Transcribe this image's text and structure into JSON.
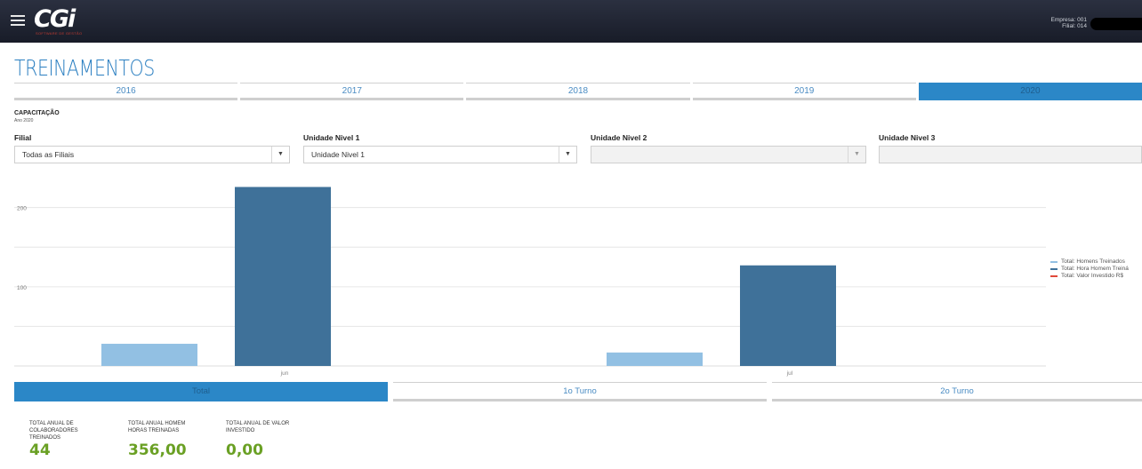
{
  "header": {
    "logo_text": "CGi",
    "logo_subtext": "SOFTWARE DE GESTÃO",
    "empresa": "Empresa: 001",
    "filial": "Filial: 014"
  },
  "page": {
    "title": "TREINAMENTOS"
  },
  "year_tabs": [
    {
      "label": "2016",
      "active": false
    },
    {
      "label": "2017",
      "active": false
    },
    {
      "label": "2018",
      "active": false
    },
    {
      "label": "2019",
      "active": false
    },
    {
      "label": "2020",
      "active": true
    }
  ],
  "section": {
    "title": "CAPACITAÇÃO",
    "subtitle": "Ano 2020"
  },
  "filters": {
    "filial": {
      "label": "Filial",
      "value": "Todas as Filiais"
    },
    "nivel1": {
      "label": "Unidade Nivel 1",
      "value": "Unidade Nivel 1"
    },
    "nivel2": {
      "label": "Unidade Nivel 2",
      "value": ""
    },
    "nivel3": {
      "label": "Unidade Nivel 3",
      "value": ""
    }
  },
  "chart_data": {
    "type": "bar",
    "categories": [
      "jun",
      "jul"
    ],
    "series": [
      {
        "name": "Total: Homens Treinados",
        "color": "#92c0e3",
        "values": [
          28,
          17
        ]
      },
      {
        "name": "Total: Hora Homem Treinadas",
        "color": "#3f7199",
        "values": [
          226,
          127
        ]
      },
      {
        "name": "Total: Valor Investido R$",
        "color": "#e0483a",
        "values": [
          0,
          0
        ]
      }
    ],
    "y_ticks": [
      "200",
      "100"
    ],
    "ylim": [
      0,
      240
    ],
    "grid": true,
    "legend": "right",
    "legend_labels": [
      "Total: Homens Treinados",
      "Total: Hora Homem Treiná",
      "Total: Valor Investido R$"
    ]
  },
  "turno_tabs": [
    {
      "label": "Total",
      "active": true
    },
    {
      "label": "1o Turno",
      "active": false
    },
    {
      "label": "2o Turno",
      "active": false
    }
  ],
  "kpis": [
    {
      "label_l1": "TOTAL ANUAL DE",
      "label_l2": "COLABORADORES",
      "label_l3": "TREINADOS",
      "value": "44"
    },
    {
      "label_l1": "TOTAL ANUAL HOMEM",
      "label_l2": "HORAS TREINADAS",
      "label_l3": "",
      "value": "356,00"
    },
    {
      "label_l1": "TOTAL ANUAL DE VALOR",
      "label_l2": "INVESTIDO",
      "label_l3": "",
      "value": "0,00"
    }
  ]
}
